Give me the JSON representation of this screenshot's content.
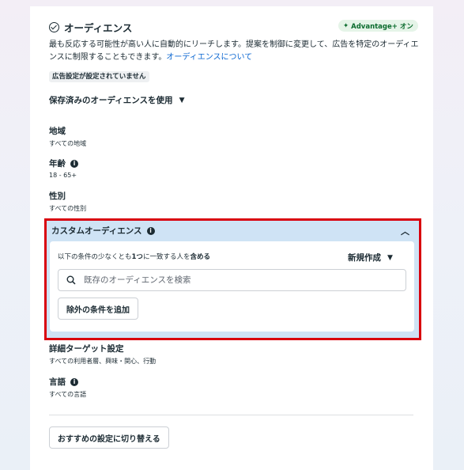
{
  "section": {
    "title": "オーディエンス",
    "advantage_badge": "Advantage+ オン",
    "description": "最も反応する可能性が高い人に自動的にリーチします。提案を制御に変更して、広告を特定のオーディエンスに制限することもできます。",
    "description_link": "オーディエンスについて",
    "status_badge": "広告設定が設定されていません",
    "saved_audience_label": "保存済みのオーディエンスを使用"
  },
  "fields": {
    "location": {
      "title": "地域",
      "value": "すべての地域"
    },
    "age": {
      "title": "年齢",
      "value": "18 - 65+"
    },
    "gender": {
      "title": "性別",
      "value": "すべての性別"
    },
    "detailed_targeting": {
      "title": "詳細ターゲット設定",
      "value": "すべての利用者層、興味・関心、行動"
    },
    "language": {
      "title": "言語",
      "value": "すべての言語"
    }
  },
  "custom_audience": {
    "title": "カスタムオーディエンス",
    "condition_prefix": "以下の条件の少なくとも",
    "condition_bold1": "1つ",
    "condition_mid": "に一致する人を",
    "condition_bold2": "含める",
    "new_create_label": "新規作成",
    "search_placeholder": "既存のオーディエンスを検索",
    "exclude_button": "除外の条件を追加"
  },
  "footer": {
    "recommended_button": "おすすめの設定に切り替える"
  },
  "colors": {
    "highlight_border": "#d9000d",
    "panel_bg": "#cfe3f5",
    "link": "#0a66d1",
    "advantage_bg": "#e5f4e8",
    "advantage_text": "#0a6b2d"
  },
  "icons": {
    "title_icon": "check-circle-icon",
    "advantage_icon": "sparkle-icon",
    "info_icon": "info-icon",
    "dropdown_icon": "caret-down-icon",
    "collapse_icon": "chevron-up-icon",
    "search_icon": "search-icon"
  }
}
